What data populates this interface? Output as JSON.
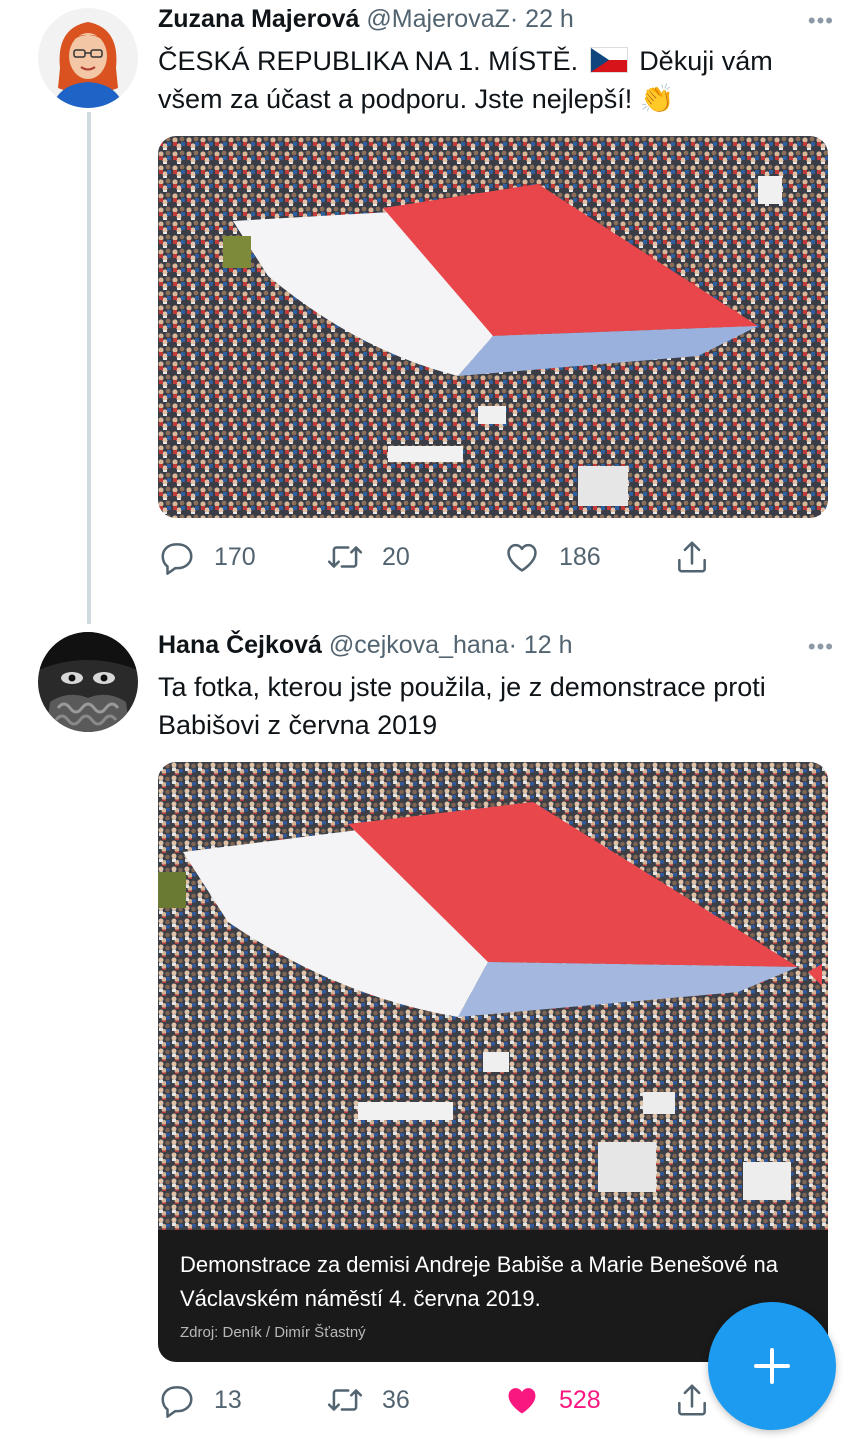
{
  "tweets": [
    {
      "author_name": "Zuzana Majerová",
      "handle": "@MajerovaZ",
      "separator": "·",
      "time": "22 h",
      "text_part1": "ČESKÁ REPUBLIKA NA 1. MÍSTĚ.",
      "flag_icon": "czech-flag-icon",
      "text_part2": "Děkuji vám všem za účast a podporu. Jste nejlepší!",
      "clap_emoji": "👏",
      "stats": {
        "replies": "170",
        "retweets": "20",
        "likes": "186"
      },
      "liked": false
    },
    {
      "author_name": "Hana Čejková",
      "handle": "@cejkova_hana",
      "separator": "·",
      "time": "12 h",
      "text": "Ta fotka, kterou jste použila, je z demonstrace proti Babišovi z června 2019",
      "image_caption": "Demonstrace za demisi Andreje Babiše a Marie Benešové na Václavském náměstí 4. června 2019.",
      "image_source": "Zdroj: Deník / Dimír Šťastný",
      "stats": {
        "replies": "13",
        "retweets": "36",
        "likes": "528"
      },
      "liked": true
    }
  ],
  "more_icon": "•••",
  "compose_icon": "plus-icon",
  "colors": {
    "accent": "#1d9bf0",
    "like_active": "#f91880",
    "secondary_text": "#536471",
    "thread_line": "#cfd9de",
    "flag_red": "#d7141a",
    "flag_blue": "#11457e"
  }
}
